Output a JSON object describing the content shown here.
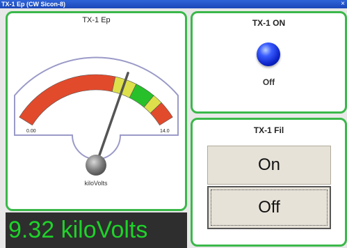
{
  "window": {
    "title": "TX-1 Ep (CW Sicon-8)",
    "close_glyph": "×"
  },
  "gauge": {
    "title": "TX-1 Ep",
    "min_label": "0.00",
    "max_label": "14.0",
    "unit": "kiloVolts",
    "min": 0,
    "max": 14,
    "value": 9.32,
    "zones": [
      {
        "from": 0,
        "to": 8.5,
        "color": "#e24a2c"
      },
      {
        "from": 8.5,
        "to": 10.2,
        "color": "#dde04a"
      },
      {
        "from": 10.2,
        "to": 11.8,
        "color": "#27c02a"
      },
      {
        "from": 11.8,
        "to": 12.6,
        "color": "#dde04a"
      },
      {
        "from": 12.6,
        "to": 14,
        "color": "#e24a2c"
      }
    ]
  },
  "readout": {
    "text": "9.32 kiloVolts",
    "color": "#1fd22a"
  },
  "tx1_on": {
    "title": "TX-1 ON",
    "status": "Off",
    "lamp_color": "#1428d8"
  },
  "tx1_fil": {
    "title": "TX-1 Fil",
    "on_label": "On",
    "off_label": "Off"
  }
}
